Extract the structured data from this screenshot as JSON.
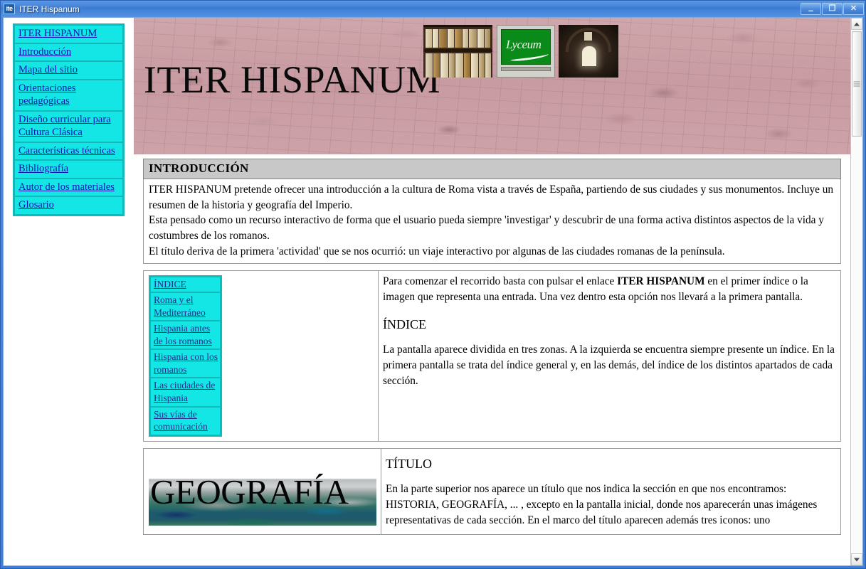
{
  "window": {
    "title": "ITER Hispanum",
    "icon_label": "ite",
    "controls": {
      "minimize": "–",
      "restore": "❐",
      "close": "✕"
    }
  },
  "sidebar": {
    "items": [
      {
        "label": "ITER HISPANUM"
      },
      {
        "label": "Introducción"
      },
      {
        "label": "Mapa del sitio"
      },
      {
        "label": "Orientaciones pedagógicas"
      },
      {
        "label": "Diseño curricular para Cultura Clásica"
      },
      {
        "label": "Características técnicas"
      },
      {
        "label": "Bibliografía"
      },
      {
        "label": "Autor de los materiales"
      },
      {
        "label": "Glosario"
      }
    ]
  },
  "banner": {
    "title": "ITER HISPANUM",
    "images": [
      {
        "name": "books-shelf-image",
        "alt": "Estantería de libros antiguos"
      },
      {
        "name": "lyceum-logo-image",
        "alt": "Lyceum",
        "text": "Lyceum"
      },
      {
        "name": "roman-corridor-image",
        "alt": "Corredor romano"
      }
    ]
  },
  "main": {
    "section_title": "INTRODUCCIÓN",
    "intro_paragraphs": [
      "ITER HISPANUM pretende ofrecer una introducción a la cultura de Roma vista a través de España, partiendo de sus ciudades y sus monumentos. Incluye un resumen de la historia y geografía del Imperio.",
      "Esta pensado como un recurso interactivo de forma que el usuario pueda siempre 'investigar' y descubrir de una forma activa distintos aspectos de la vida y costumbres de los romanos.",
      "El título deriva de la primera 'actividad' que se nos ocurrió: un viaje interactivo por algunas de las ciudades romanas de la península."
    ],
    "index_box": {
      "items": [
        {
          "label": "ÍNDICE"
        },
        {
          "label": "Roma y el Mediterráneo"
        },
        {
          "label": "Hispania antes de los romanos"
        },
        {
          "label": "Hispania con los romanos"
        },
        {
          "label": "Las ciudades de Hispania"
        },
        {
          "label": "Sus vías de comunicación"
        }
      ]
    },
    "row1_right": {
      "lead_before": "Para comenzar el recorrido basta con pulsar el enlace ",
      "lead_bold": "ITER HISPANUM",
      "lead_after": " en el primer índice o la imagen que representa una entrada. Una vez dentro esta opción nos llevará a la primera pantalla.",
      "heading": "ÍNDICE",
      "body": "La pantalla aparece dividida en tres zonas. A la izquierda se encuentra siempre presente un índice. En la primera pantalla se trata del índice general y, en las demás, del índice de los distintos apartados de cada sección."
    },
    "row2_left_image": {
      "name": "geografia-image",
      "label": "GEOGRAFÍA"
    },
    "row2_right": {
      "heading": "TÍTULO",
      "body": "En la parte superior nos aparece un título que nos indica la sección en que nos encontramos: HISTORIA, GEOGRAFÍA, ... , excepto en la pantalla inicial, donde nos aparecerán unas imágenes representativas de cada sección. En el marco del título aparecen además tres iconos: uno"
    }
  },
  "colors": {
    "nav_background": "#14e6e6",
    "nav_border": "#14b8b8",
    "link": "#1414b4",
    "banner_background": "#cfa3a8",
    "section_header": "#c8c8c8",
    "titlebar": "#3f7fd8"
  }
}
